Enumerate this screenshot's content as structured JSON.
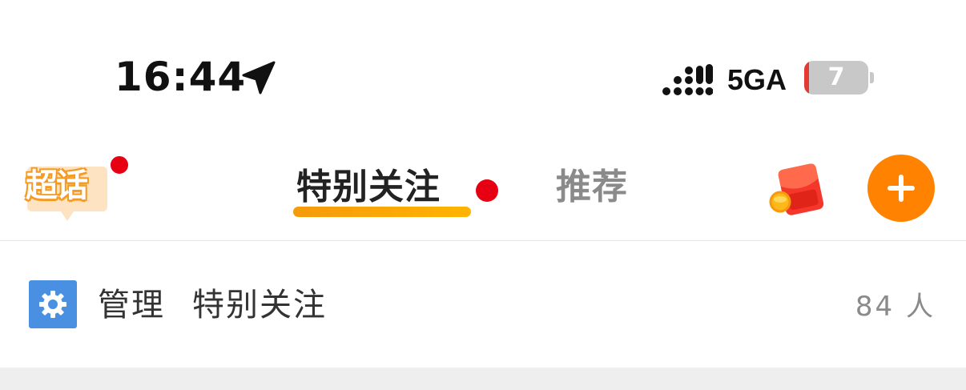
{
  "status_bar": {
    "time": "16:44",
    "network": "5GA",
    "battery": "7",
    "location_icon": "location-arrow-icon",
    "signal_icon": "signal-dots-icon"
  },
  "nav": {
    "logo_text": "超话",
    "tabs": [
      {
        "label": "特别关注",
        "active": true,
        "has_dot": true
      },
      {
        "label": "推荐",
        "active": false
      }
    ],
    "redpacket_icon": "red-packet-icon",
    "add_icon": "plus-icon",
    "colors": {
      "accent": "#ff8200",
      "dot": "#e60012"
    }
  },
  "manage_row": {
    "label": "管理",
    "target": "特别关注",
    "count": "84 人",
    "icon": "gear-icon",
    "icon_color": "#4a90e2"
  }
}
